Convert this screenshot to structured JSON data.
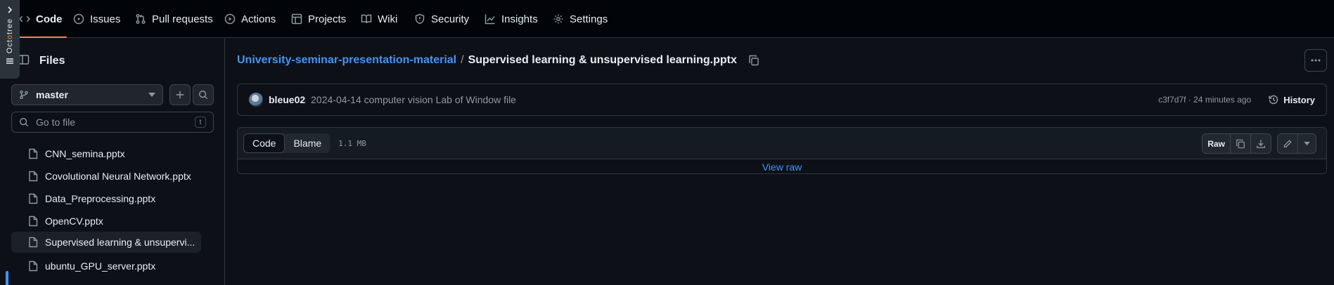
{
  "nav": {
    "tabs": [
      {
        "label": "Code",
        "icon": "code-icon"
      },
      {
        "label": "Issues",
        "icon": "issue-opened-icon"
      },
      {
        "label": "Pull requests",
        "icon": "git-pull-request-icon"
      },
      {
        "label": "Actions",
        "icon": "play-icon"
      },
      {
        "label": "Projects",
        "icon": "table-icon"
      },
      {
        "label": "Wiki",
        "icon": "book-icon"
      },
      {
        "label": "Security",
        "icon": "shield-icon"
      },
      {
        "label": "Insights",
        "icon": "graph-icon"
      },
      {
        "label": "Settings",
        "icon": "gear-icon"
      }
    ],
    "active_tab": "Code"
  },
  "octotree": {
    "label_pre": "Oct",
    "label_o": "o",
    "label_post": "tree"
  },
  "sidebar": {
    "title": "Files",
    "branch": "master",
    "goto_placeholder": "Go to file",
    "goto_shortcut": "t",
    "files": [
      {
        "label": "CNN_semina.pptx"
      },
      {
        "label": "Covolutional Neural Network.pptx"
      },
      {
        "label": "Data_Preprocessing.pptx"
      },
      {
        "label": "OpenCV.pptx"
      },
      {
        "label": "Supervised learning & unsupervi..."
      },
      {
        "label": "ubuntu_GPU_server.pptx"
      }
    ],
    "selected_index": 4
  },
  "breadcrumb": {
    "repo": "University-seminar-presentation-material",
    "separator": "/",
    "file": "Supervised learning & unsupervised learning.pptx"
  },
  "commit": {
    "author": "bleue02",
    "message": "2024-04-14 computer vision Lab of Window file",
    "meta": "c3f7d7f · 24 minutes ago",
    "history_label": "History"
  },
  "file_view": {
    "code_label": "Code",
    "blame_label": "Blame",
    "size": "1.1 MB",
    "raw_label": "Raw",
    "view_raw_label": "View raw"
  },
  "colors": {
    "background": "#0d1117",
    "link": "#4493f8",
    "active_underline": "#f78166",
    "octotree_accent": "#f0883e"
  }
}
